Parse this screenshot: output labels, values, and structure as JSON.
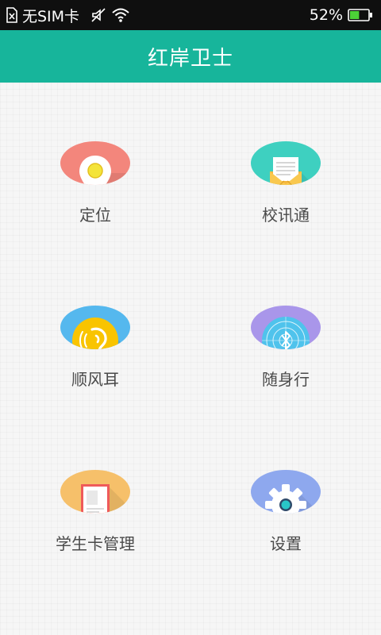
{
  "status_bar": {
    "sim_text": "无SIM卡",
    "battery_percent": "52%",
    "battery_level": 0.52,
    "icons": [
      "sim-icon",
      "mute-icon",
      "wifi-icon",
      "battery-icon"
    ]
  },
  "app_bar": {
    "title": "红岸卫士"
  },
  "menu": [
    {
      "label": "定位",
      "icon": "location-pin-icon",
      "color": "#f3867c"
    },
    {
      "label": "校讯通",
      "icon": "envelope-icon",
      "color": "#3ed0c0"
    },
    {
      "label": "顺风耳",
      "icon": "ear-icon",
      "color": "#55b8ee"
    },
    {
      "label": "随身行",
      "icon": "bluetooth-radar-icon",
      "color": "#a996ea"
    },
    {
      "label": "学生卡管理",
      "icon": "student-card-icon",
      "color": "#f6c06a"
    },
    {
      "label": "设置",
      "icon": "gear-icon",
      "color": "#8ea8ee"
    }
  ]
}
